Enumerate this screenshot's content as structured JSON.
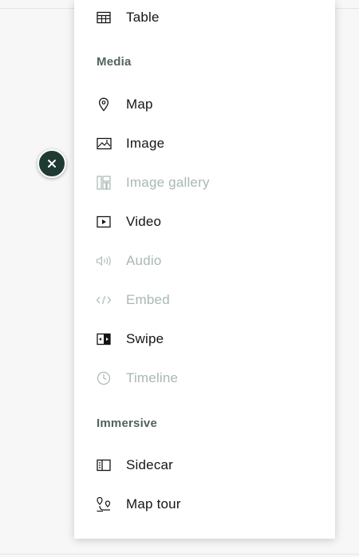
{
  "menu": {
    "items_top": [
      {
        "label": "Table",
        "icon": "table-icon",
        "disabled": false
      }
    ],
    "sections": [
      {
        "title": "Media",
        "items": [
          {
            "label": "Map",
            "icon": "map-pin-icon",
            "disabled": false
          },
          {
            "label": "Image",
            "icon": "image-icon",
            "disabled": false
          },
          {
            "label": "Image gallery",
            "icon": "image-gallery-icon",
            "disabled": true
          },
          {
            "label": "Video",
            "icon": "video-icon",
            "disabled": false
          },
          {
            "label": "Audio",
            "icon": "audio-icon",
            "disabled": true
          },
          {
            "label": "Embed",
            "icon": "embed-icon",
            "disabled": true
          },
          {
            "label": "Swipe",
            "icon": "swipe-icon",
            "disabled": false
          },
          {
            "label": "Timeline",
            "icon": "timeline-icon",
            "disabled": true
          }
        ]
      },
      {
        "title": "Immersive",
        "items": [
          {
            "label": "Sidecar",
            "icon": "sidecar-icon",
            "disabled": false
          },
          {
            "label": "Map tour",
            "icon": "map-tour-icon",
            "disabled": false
          }
        ]
      }
    ]
  },
  "close_button": {
    "icon": "close-icon"
  },
  "colors": {
    "panel_bg": "#ffffff",
    "close_bg": "#1f3a33",
    "text": "#151515",
    "disabled_text": "#a8b8b4",
    "section_title": "#52635f"
  }
}
